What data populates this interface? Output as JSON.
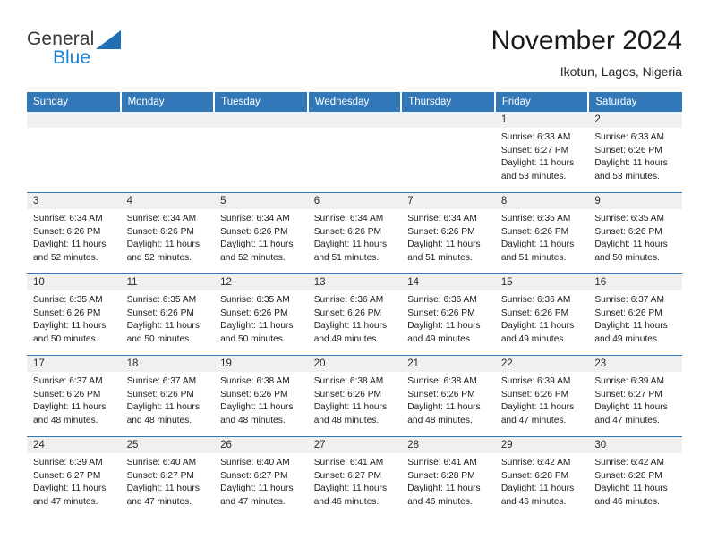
{
  "brand": {
    "name_part1": "General",
    "name_part2": "Blue",
    "logo_colors": {
      "text": "#3a3a3a",
      "accent": "#1d84d4",
      "triangle": "#1f6fb5"
    }
  },
  "header": {
    "title": "November 2024",
    "location": "Ikotun, Lagos, Nigeria"
  },
  "theme": {
    "header_blue": "#3277b8",
    "daynum_gray": "#f0f0f0",
    "grid_line": "#3277b8"
  },
  "calendar": {
    "weekday_headers": [
      "Sunday",
      "Monday",
      "Tuesday",
      "Wednesday",
      "Thursday",
      "Friday",
      "Saturday"
    ],
    "weeks": [
      [
        {
          "day": "",
          "sunrise": "",
          "sunset": "",
          "daylight_line1": "",
          "daylight_line2": "",
          "empty": true
        },
        {
          "day": "",
          "sunrise": "",
          "sunset": "",
          "daylight_line1": "",
          "daylight_line2": "",
          "empty": true
        },
        {
          "day": "",
          "sunrise": "",
          "sunset": "",
          "daylight_line1": "",
          "daylight_line2": "",
          "empty": true
        },
        {
          "day": "",
          "sunrise": "",
          "sunset": "",
          "daylight_line1": "",
          "daylight_line2": "",
          "empty": true
        },
        {
          "day": "",
          "sunrise": "",
          "sunset": "",
          "daylight_line1": "",
          "daylight_line2": "",
          "empty": true
        },
        {
          "day": "1",
          "sunrise": "Sunrise: 6:33 AM",
          "sunset": "Sunset: 6:27 PM",
          "daylight_line1": "Daylight: 11 hours",
          "daylight_line2": "and 53 minutes."
        },
        {
          "day": "2",
          "sunrise": "Sunrise: 6:33 AM",
          "sunset": "Sunset: 6:26 PM",
          "daylight_line1": "Daylight: 11 hours",
          "daylight_line2": "and 53 minutes."
        }
      ],
      [
        {
          "day": "3",
          "sunrise": "Sunrise: 6:34 AM",
          "sunset": "Sunset: 6:26 PM",
          "daylight_line1": "Daylight: 11 hours",
          "daylight_line2": "and 52 minutes."
        },
        {
          "day": "4",
          "sunrise": "Sunrise: 6:34 AM",
          "sunset": "Sunset: 6:26 PM",
          "daylight_line1": "Daylight: 11 hours",
          "daylight_line2": "and 52 minutes."
        },
        {
          "day": "5",
          "sunrise": "Sunrise: 6:34 AM",
          "sunset": "Sunset: 6:26 PM",
          "daylight_line1": "Daylight: 11 hours",
          "daylight_line2": "and 52 minutes."
        },
        {
          "day": "6",
          "sunrise": "Sunrise: 6:34 AM",
          "sunset": "Sunset: 6:26 PM",
          "daylight_line1": "Daylight: 11 hours",
          "daylight_line2": "and 51 minutes."
        },
        {
          "day": "7",
          "sunrise": "Sunrise: 6:34 AM",
          "sunset": "Sunset: 6:26 PM",
          "daylight_line1": "Daylight: 11 hours",
          "daylight_line2": "and 51 minutes."
        },
        {
          "day": "8",
          "sunrise": "Sunrise: 6:35 AM",
          "sunset": "Sunset: 6:26 PM",
          "daylight_line1": "Daylight: 11 hours",
          "daylight_line2": "and 51 minutes."
        },
        {
          "day": "9",
          "sunrise": "Sunrise: 6:35 AM",
          "sunset": "Sunset: 6:26 PM",
          "daylight_line1": "Daylight: 11 hours",
          "daylight_line2": "and 50 minutes."
        }
      ],
      [
        {
          "day": "10",
          "sunrise": "Sunrise: 6:35 AM",
          "sunset": "Sunset: 6:26 PM",
          "daylight_line1": "Daylight: 11 hours",
          "daylight_line2": "and 50 minutes."
        },
        {
          "day": "11",
          "sunrise": "Sunrise: 6:35 AM",
          "sunset": "Sunset: 6:26 PM",
          "daylight_line1": "Daylight: 11 hours",
          "daylight_line2": "and 50 minutes."
        },
        {
          "day": "12",
          "sunrise": "Sunrise: 6:35 AM",
          "sunset": "Sunset: 6:26 PM",
          "daylight_line1": "Daylight: 11 hours",
          "daylight_line2": "and 50 minutes."
        },
        {
          "day": "13",
          "sunrise": "Sunrise: 6:36 AM",
          "sunset": "Sunset: 6:26 PM",
          "daylight_line1": "Daylight: 11 hours",
          "daylight_line2": "and 49 minutes."
        },
        {
          "day": "14",
          "sunrise": "Sunrise: 6:36 AM",
          "sunset": "Sunset: 6:26 PM",
          "daylight_line1": "Daylight: 11 hours",
          "daylight_line2": "and 49 minutes."
        },
        {
          "day": "15",
          "sunrise": "Sunrise: 6:36 AM",
          "sunset": "Sunset: 6:26 PM",
          "daylight_line1": "Daylight: 11 hours",
          "daylight_line2": "and 49 minutes."
        },
        {
          "day": "16",
          "sunrise": "Sunrise: 6:37 AM",
          "sunset": "Sunset: 6:26 PM",
          "daylight_line1": "Daylight: 11 hours",
          "daylight_line2": "and 49 minutes."
        }
      ],
      [
        {
          "day": "17",
          "sunrise": "Sunrise: 6:37 AM",
          "sunset": "Sunset: 6:26 PM",
          "daylight_line1": "Daylight: 11 hours",
          "daylight_line2": "and 48 minutes."
        },
        {
          "day": "18",
          "sunrise": "Sunrise: 6:37 AM",
          "sunset": "Sunset: 6:26 PM",
          "daylight_line1": "Daylight: 11 hours",
          "daylight_line2": "and 48 minutes."
        },
        {
          "day": "19",
          "sunrise": "Sunrise: 6:38 AM",
          "sunset": "Sunset: 6:26 PM",
          "daylight_line1": "Daylight: 11 hours",
          "daylight_line2": "and 48 minutes."
        },
        {
          "day": "20",
          "sunrise": "Sunrise: 6:38 AM",
          "sunset": "Sunset: 6:26 PM",
          "daylight_line1": "Daylight: 11 hours",
          "daylight_line2": "and 48 minutes."
        },
        {
          "day": "21",
          "sunrise": "Sunrise: 6:38 AM",
          "sunset": "Sunset: 6:26 PM",
          "daylight_line1": "Daylight: 11 hours",
          "daylight_line2": "and 48 minutes."
        },
        {
          "day": "22",
          "sunrise": "Sunrise: 6:39 AM",
          "sunset": "Sunset: 6:26 PM",
          "daylight_line1": "Daylight: 11 hours",
          "daylight_line2": "and 47 minutes."
        },
        {
          "day": "23",
          "sunrise": "Sunrise: 6:39 AM",
          "sunset": "Sunset: 6:27 PM",
          "daylight_line1": "Daylight: 11 hours",
          "daylight_line2": "and 47 minutes."
        }
      ],
      [
        {
          "day": "24",
          "sunrise": "Sunrise: 6:39 AM",
          "sunset": "Sunset: 6:27 PM",
          "daylight_line1": "Daylight: 11 hours",
          "daylight_line2": "and 47 minutes."
        },
        {
          "day": "25",
          "sunrise": "Sunrise: 6:40 AM",
          "sunset": "Sunset: 6:27 PM",
          "daylight_line1": "Daylight: 11 hours",
          "daylight_line2": "and 47 minutes."
        },
        {
          "day": "26",
          "sunrise": "Sunrise: 6:40 AM",
          "sunset": "Sunset: 6:27 PM",
          "daylight_line1": "Daylight: 11 hours",
          "daylight_line2": "and 47 minutes."
        },
        {
          "day": "27",
          "sunrise": "Sunrise: 6:41 AM",
          "sunset": "Sunset: 6:27 PM",
          "daylight_line1": "Daylight: 11 hours",
          "daylight_line2": "and 46 minutes."
        },
        {
          "day": "28",
          "sunrise": "Sunrise: 6:41 AM",
          "sunset": "Sunset: 6:28 PM",
          "daylight_line1": "Daylight: 11 hours",
          "daylight_line2": "and 46 minutes."
        },
        {
          "day": "29",
          "sunrise": "Sunrise: 6:42 AM",
          "sunset": "Sunset: 6:28 PM",
          "daylight_line1": "Daylight: 11 hours",
          "daylight_line2": "and 46 minutes."
        },
        {
          "day": "30",
          "sunrise": "Sunrise: 6:42 AM",
          "sunset": "Sunset: 6:28 PM",
          "daylight_line1": "Daylight: 11 hours",
          "daylight_line2": "and 46 minutes."
        }
      ]
    ]
  }
}
